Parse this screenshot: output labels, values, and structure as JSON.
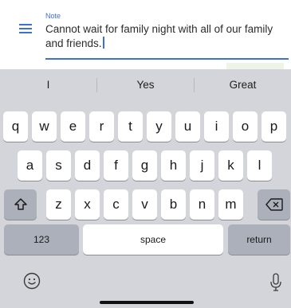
{
  "note": {
    "label": "Note",
    "text": "Cannot wait for family night with all of our family and friends.",
    "icon": "notes-lines-icon",
    "accent_color": "#3f6fd8"
  },
  "keyboard": {
    "suggestions": [
      "I",
      "Yes",
      "Great"
    ],
    "row1": [
      "q",
      "w",
      "e",
      "r",
      "t",
      "y",
      "u",
      "i",
      "o",
      "p"
    ],
    "row2": [
      "a",
      "s",
      "d",
      "f",
      "g",
      "h",
      "j",
      "k",
      "l"
    ],
    "row3": [
      "z",
      "x",
      "c",
      "v",
      "b",
      "n",
      "m"
    ],
    "shift_icon": "shift-arrow-icon",
    "delete_icon": "backspace-icon",
    "numbers_label": "123",
    "space_label": "space",
    "return_label": "return",
    "emoji_icon": "emoji-icon",
    "mic_icon": "microphone-icon",
    "background_color": "#d3d5da"
  }
}
